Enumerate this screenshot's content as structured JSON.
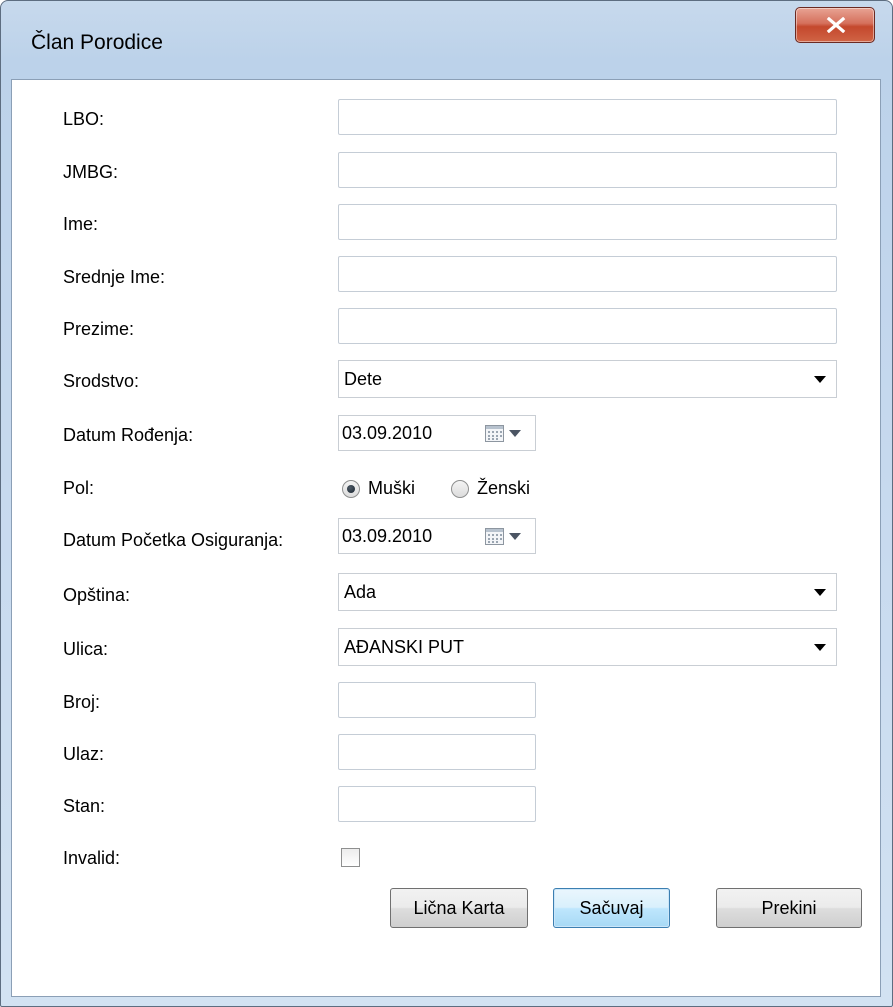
{
  "window": {
    "title": "Član Porodice"
  },
  "form": {
    "lbo_label": "LBO:",
    "jmbg_label": "JMBG:",
    "ime_label": "Ime:",
    "srednje_ime_label": "Srednje Ime:",
    "prezime_label": "Prezime:",
    "srodstvo_label": "Srodstvo:",
    "srodstvo_value": "Dete",
    "datum_rodjenja_label": "Datum Rođenja:",
    "datum_rodjenja_value": "03.09.2010",
    "pol_label": "Pol:",
    "pol_options": [
      "Muški",
      "Ženski"
    ],
    "pol_selected": "Muški",
    "datum_pocetka_label": "Datum Početka Osiguranja:",
    "datum_pocetka_value": "03.09.2010",
    "opstina_label": "Opština:",
    "opstina_value": "Ada",
    "ulica_label": "Ulica:",
    "ulica_value": "AĐANSKI PUT",
    "broj_label": "Broj:",
    "ulaz_label": "Ulaz:",
    "stan_label": "Stan:",
    "invalid_label": "Invalid:",
    "invalid_checked": false
  },
  "buttons": {
    "licna_karta": "Lična Karta",
    "sacuvaj": "Sačuvaj",
    "prekini": "Prekini"
  },
  "icons": [
    "close-icon",
    "calendar-icon",
    "chevron-down-icon"
  ]
}
